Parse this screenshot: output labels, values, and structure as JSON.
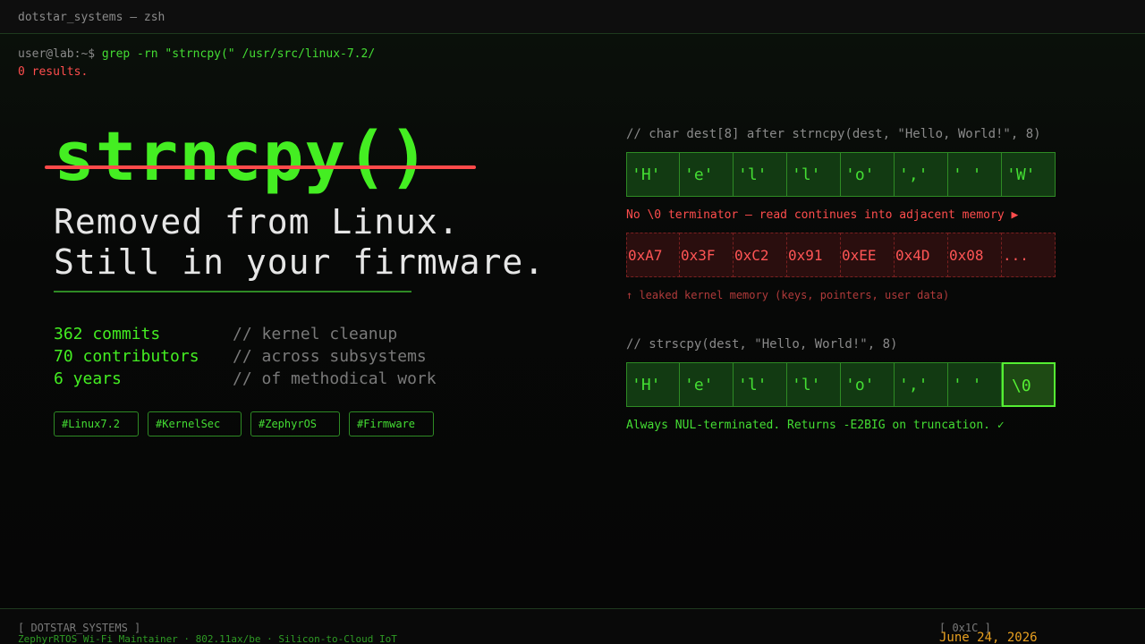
{
  "window": {
    "title": "dotstar_systems — zsh"
  },
  "terminal": {
    "prompt": "user@lab:~$ ",
    "command": "grep -rn \"strncpy(\" /usr/src/linux-7.2/",
    "results": "0 results."
  },
  "hero": {
    "function_name": "strncpy()",
    "line1": "Removed from Linux.",
    "line2": "Still in your firmware."
  },
  "stats": [
    {
      "value": "362 commits",
      "comment": "// kernel cleanup"
    },
    {
      "value": "70 contributors",
      "comment": "// across subsystems"
    },
    {
      "value": "6 years",
      "comment": "// of methodical work"
    }
  ],
  "tags": [
    "#Linux7.2",
    "#KernelSec",
    "#ZephyrOS",
    "#Firmware"
  ],
  "strncpy_demo": {
    "caption": "// char dest[8] after strncpy(dest, \"Hello, World!\", 8)",
    "cells": [
      "'H'",
      "'e'",
      "'l'",
      "'l'",
      "'o'",
      "','",
      "' '",
      "'W'"
    ],
    "warning": "No \\0 terminator — read continues into adjacent memory ▶",
    "leak_cells": [
      "0xA7",
      "0x3F",
      "0xC2",
      "0x91",
      "0xEE",
      "0x4D",
      "0x08",
      "..."
    ],
    "leak_note": "↑ leaked kernel memory (keys, pointers, user data)"
  },
  "strscpy_demo": {
    "caption": "// strscpy(dest, \"Hello, World!\", 8)",
    "cells": [
      "'H'",
      "'e'",
      "'l'",
      "'l'",
      "'o'",
      "','",
      "' '",
      "\\0"
    ],
    "note": "Always NUL-terminated. Returns -E2BIG on truncation. ✓"
  },
  "footer": {
    "brand": "[ DOTSTAR_SYSTEMS ]",
    "subtitle": "ZephyrRTOS Wi-Fi Maintainer · 802.11ax/be · Silicon-to-Cloud IoT",
    "code": "[ 0x1C ]",
    "date": "June 24, 2026"
  },
  "colors": {
    "accent": "#44ee22",
    "danger": "#ff4d4d",
    "date": "#e8a020"
  }
}
